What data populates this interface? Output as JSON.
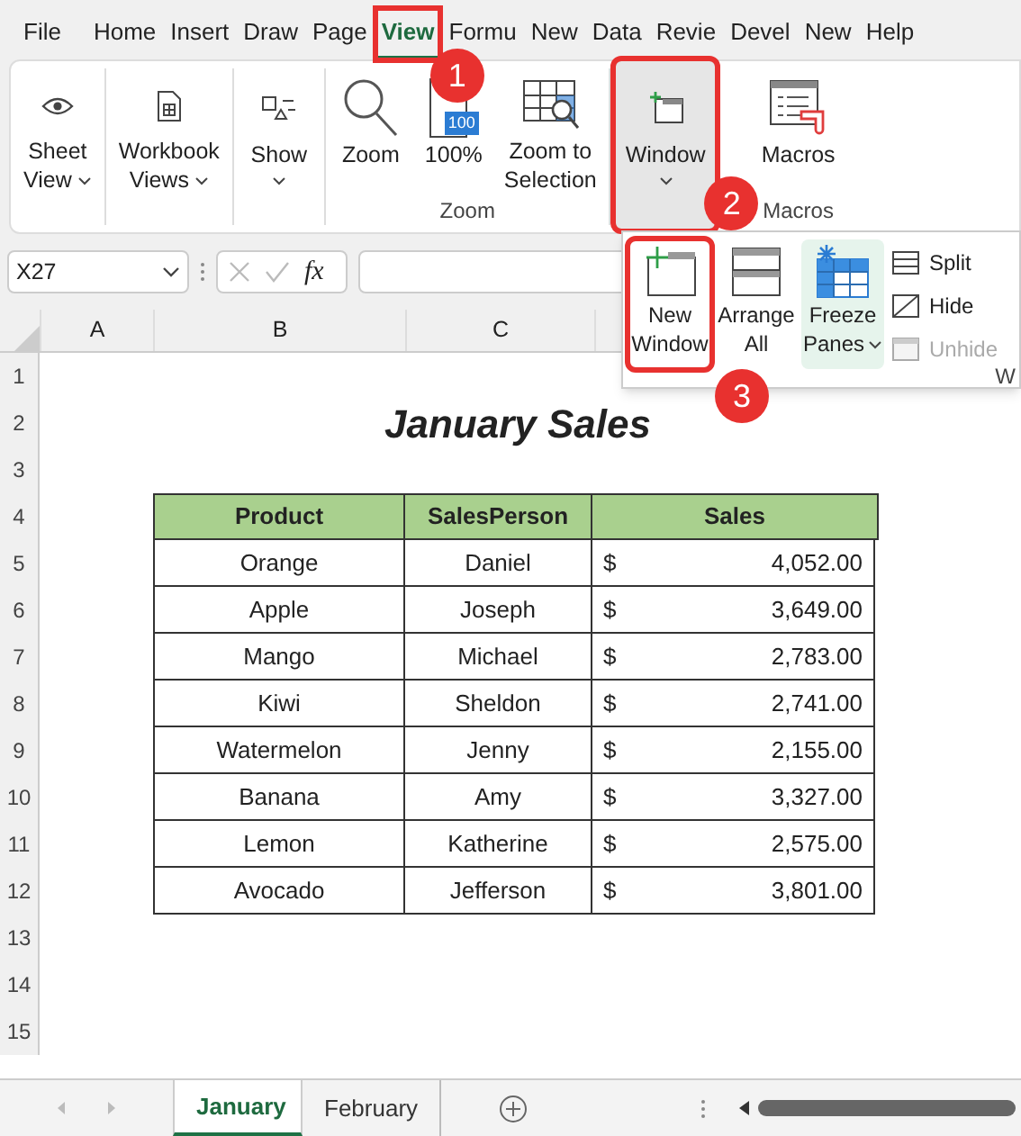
{
  "menu_tabs": [
    {
      "label": "File",
      "selected": false
    },
    {
      "label": "Home",
      "selected": false
    },
    {
      "label": "Insert",
      "selected": false
    },
    {
      "label": "Draw",
      "selected": false
    },
    {
      "label": "Page",
      "selected": false
    },
    {
      "label": "View",
      "selected": true,
      "framed": true,
      "callout": "1"
    },
    {
      "label": "Formu",
      "selected": false
    },
    {
      "label": "New",
      "selected": false
    },
    {
      "label": "Data",
      "selected": false
    },
    {
      "label": "Revie",
      "selected": false
    },
    {
      "label": "Devel",
      "selected": false
    },
    {
      "label": "New",
      "selected": false
    },
    {
      "label": "Help",
      "selected": false
    }
  ],
  "ribbon": {
    "groups": [
      {
        "buttons": [
          {
            "kind": "eye",
            "lines": [
              "Sheet",
              "View"
            ],
            "caret": true,
            "pressed": false,
            "framed": false
          }
        ]
      },
      {
        "buttons": [
          {
            "kind": "workbook",
            "lines": [
              "Workbook",
              "Views"
            ],
            "caret": true,
            "pressed": false,
            "framed": false
          }
        ]
      },
      {
        "buttons": [
          {
            "kind": "show",
            "lines": [
              "Show"
            ],
            "caret": true,
            "pressed": false,
            "framed": false
          }
        ]
      },
      {
        "label": "Zoom",
        "buttons": [
          {
            "kind": "zoom",
            "lines": [
              "Zoom"
            ],
            "caret": false,
            "pressed": false,
            "framed": false
          },
          {
            "kind": "hundred",
            "icon_text": "100",
            "lines": [
              "100%"
            ],
            "caret": false,
            "pressed": false,
            "framed": false
          },
          {
            "kind": "selection",
            "lines": [
              "Zoom to",
              "Selection"
            ],
            "caret": false,
            "pressed": false,
            "framed": false
          }
        ]
      },
      {
        "buttons": [
          {
            "kind": "window",
            "lines": [
              "Window"
            ],
            "caret": true,
            "pressed": true,
            "framed": true,
            "callout": "2"
          }
        ]
      },
      {
        "label": "Macros",
        "buttons": [
          {
            "kind": "macros",
            "lines": [
              "Macros"
            ],
            "caret": false,
            "pressed": false,
            "framed": false
          }
        ]
      }
    ]
  },
  "window_menu": {
    "large": [
      {
        "kind": "new",
        "lines": [
          "New",
          "Window"
        ],
        "caret": false,
        "highlighted": false,
        "framed": true,
        "callout": "3"
      },
      {
        "kind": "arrange",
        "lines": [
          "Arrange",
          "All"
        ],
        "caret": false,
        "highlighted": false,
        "framed": false
      },
      {
        "kind": "freeze",
        "lines": [
          "Freeze",
          "Panes"
        ],
        "caret": true,
        "highlighted": true,
        "framed": false
      }
    ],
    "small": [
      {
        "kind": "split",
        "label": "Split",
        "disabled": false
      },
      {
        "kind": "hide",
        "label": "Hide",
        "disabled": false
      },
      {
        "kind": "unhide",
        "label": "Unhide",
        "disabled": true
      }
    ],
    "group_label": "W"
  },
  "formula_bar": {
    "name_box": "X27",
    "fx": "fx"
  },
  "column_headers": [
    "A",
    "B",
    "C"
  ],
  "row_headers": [
    "1",
    "2",
    "3",
    "4",
    "5",
    "6",
    "7",
    "8",
    "9",
    "10",
    "11",
    "12",
    "13",
    "14",
    "15"
  ],
  "title": "January Sales",
  "table": {
    "columns": [
      "Product",
      "SalesPerson",
      "Sales"
    ],
    "rows": [
      {
        "product": "Orange",
        "salesperson": "Daniel",
        "sales": {
          "currency": "$",
          "amount": "4,052.00"
        }
      },
      {
        "product": "Apple",
        "salesperson": "Joseph",
        "sales": {
          "currency": "$",
          "amount": "3,649.00"
        }
      },
      {
        "product": "Mango",
        "salesperson": "Michael",
        "sales": {
          "currency": "$",
          "amount": "2,783.00"
        }
      },
      {
        "product": "Kiwi",
        "salesperson": "Sheldon",
        "sales": {
          "currency": "$",
          "amount": "2,741.00"
        }
      },
      {
        "product": "Watermelon",
        "salesperson": "Jenny",
        "sales": {
          "currency": "$",
          "amount": "2,155.00"
        }
      },
      {
        "product": "Banana",
        "salesperson": "Amy",
        "sales": {
          "currency": "$",
          "amount": "3,327.00"
        }
      },
      {
        "product": "Lemon",
        "salesperson": "Katherine",
        "sales": {
          "currency": "$",
          "amount": "2,575.00"
        }
      },
      {
        "product": "Avocado",
        "salesperson": "Jefferson",
        "sales": {
          "currency": "$",
          "amount": "3,801.00"
        }
      }
    ]
  },
  "sheet_tabs": [
    {
      "label": "January",
      "selected": true
    },
    {
      "label": "February",
      "selected": false
    }
  ]
}
